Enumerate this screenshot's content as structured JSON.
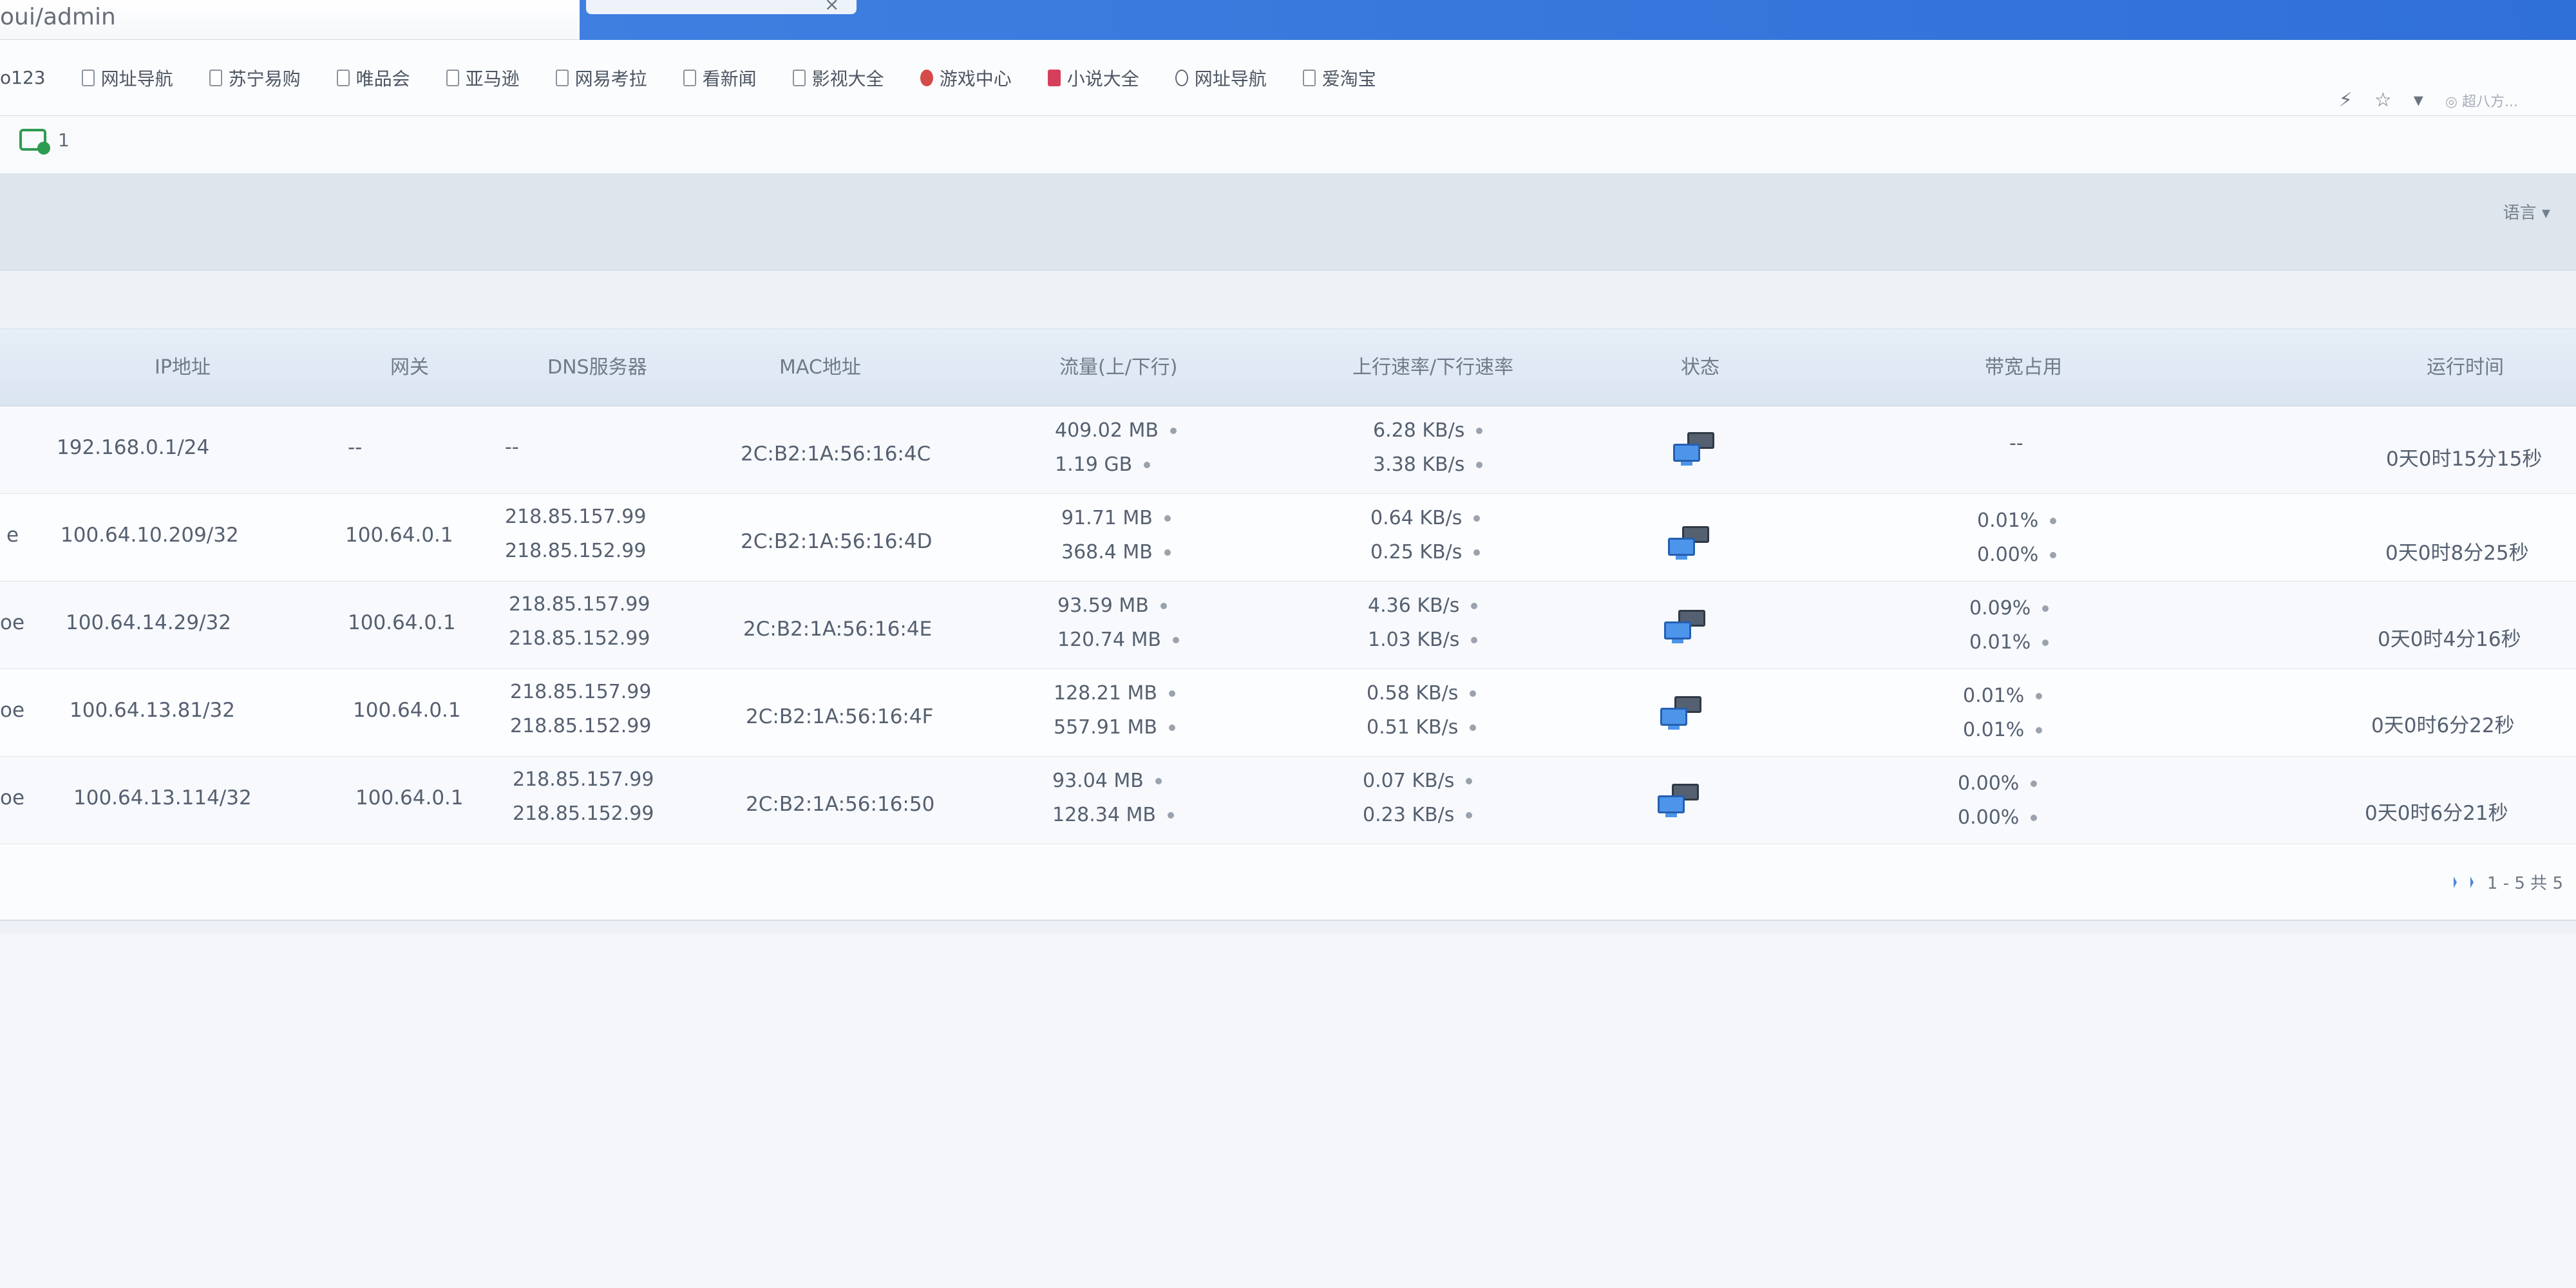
{
  "browser": {
    "address": "oui/admin",
    "bookmarks": [
      {
        "label": "o123",
        "icon": "none"
      },
      {
        "label": "网址导航",
        "icon": "page-icon"
      },
      {
        "label": "苏宁易购",
        "icon": "page-icon"
      },
      {
        "label": "唯品会",
        "icon": "page-icon"
      },
      {
        "label": "亚马逊",
        "icon": "page-icon"
      },
      {
        "label": "网易考拉",
        "icon": "page-icon"
      },
      {
        "label": "看新闻",
        "icon": "page-icon"
      },
      {
        "label": "影视大全",
        "icon": "page-icon"
      },
      {
        "label": "游戏中心",
        "icon": "game-icon"
      },
      {
        "label": "小说大全",
        "icon": "book-icon"
      },
      {
        "label": "网址导航",
        "icon": "globe-icon"
      },
      {
        "label": "爱淘宝",
        "icon": "page-icon"
      }
    ],
    "toolbar": {
      "lightning": "⚡",
      "star": "☆",
      "menu": "▾",
      "user": "◎ 超八方..."
    }
  },
  "app": {
    "tray_count": "1",
    "language_label": "语言 ▾"
  },
  "table": {
    "headers": [
      "IP地址",
      "网关",
      "DNS服务器",
      "MAC地址",
      "流量(上/下行)",
      "上行速率/下行速率",
      "状态",
      "带宽占用",
      "运行时间"
    ],
    "rows": [
      {
        "prefix": "",
        "ip": "192.168.0.1/24",
        "gateway": "--",
        "dns": [
          "--",
          ""
        ],
        "mac": "2C:B2:1A:56:16:4C",
        "traffic": [
          "409.02 MB",
          "1.19 GB"
        ],
        "rate": [
          "6.28 KB/s",
          "3.38 KB/s"
        ],
        "bandwidth": [
          "--",
          ""
        ],
        "uptime": "0天0时15分15秒"
      },
      {
        "prefix": "e",
        "ip": "100.64.10.209/32",
        "gateway": "100.64.0.1",
        "dns": [
          "218.85.157.99",
          "218.85.152.99"
        ],
        "mac": "2C:B2:1A:56:16:4D",
        "traffic": [
          "91.71 MB",
          "368.4 MB"
        ],
        "rate": [
          "0.64 KB/s",
          "0.25 KB/s"
        ],
        "bandwidth": [
          "0.01%",
          "0.00%"
        ],
        "uptime": "0天0时8分25秒"
      },
      {
        "prefix": "oe",
        "ip": "100.64.14.29/32",
        "gateway": "100.64.0.1",
        "dns": [
          "218.85.157.99",
          "218.85.152.99"
        ],
        "mac": "2C:B2:1A:56:16:4E",
        "traffic": [
          "93.59 MB",
          "120.74 MB"
        ],
        "rate": [
          "4.36 KB/s",
          "1.03 KB/s"
        ],
        "bandwidth": [
          "0.09%",
          "0.01%"
        ],
        "uptime": "0天0时4分16秒"
      },
      {
        "prefix": "oe",
        "ip": "100.64.13.81/32",
        "gateway": "100.64.0.1",
        "dns": [
          "218.85.157.99",
          "218.85.152.99"
        ],
        "mac": "2C:B2:1A:56:16:4F",
        "traffic": [
          "128.21 MB",
          "557.91 MB"
        ],
        "rate": [
          "0.58 KB/s",
          "0.51 KB/s"
        ],
        "bandwidth": [
          "0.01%",
          "0.01%"
        ],
        "uptime": "0天0时6分22秒"
      },
      {
        "prefix": "oe",
        "ip": "100.64.13.114/32",
        "gateway": "100.64.0.1",
        "dns": [
          "218.85.157.99",
          "218.85.152.99"
        ],
        "mac": "2C:B2:1A:56:16:50",
        "traffic": [
          "93.04 MB",
          "128.34 MB"
        ],
        "rate": [
          "0.07 KB/s",
          "0.23 KB/s"
        ],
        "bandwidth": [
          "0.00%",
          "0.00%"
        ],
        "uptime": "0天0时6分21秒"
      }
    ],
    "pager_text": "1 - 5 共 5"
  }
}
